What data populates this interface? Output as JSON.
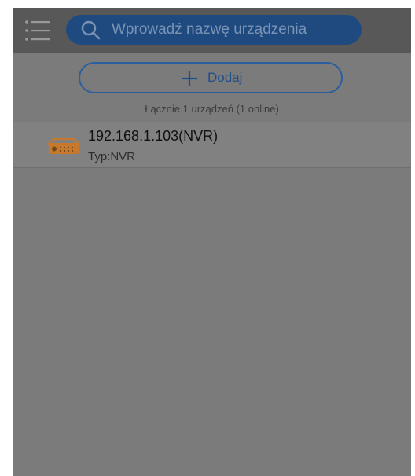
{
  "search": {
    "placeholder": "Wprowadź nazwę urządzenia"
  },
  "add_button": {
    "label": "Dodaj"
  },
  "summary": "Łącznie 1 urządzeń (1 online)",
  "devices": [
    {
      "name": "192.168.1.103(NVR)",
      "type": "Typ:NVR",
      "icon": "nvr-device-icon",
      "more": "···"
    }
  ],
  "colors": {
    "topbar": "#585858",
    "search_bg": "#1f4a80",
    "accent": "#2a5e9e",
    "device_icon": "#c8782a",
    "background": "#7b7b7b"
  },
  "icons": {
    "menu": "menu-icon",
    "search": "search-icon",
    "add": "plus-icon"
  }
}
